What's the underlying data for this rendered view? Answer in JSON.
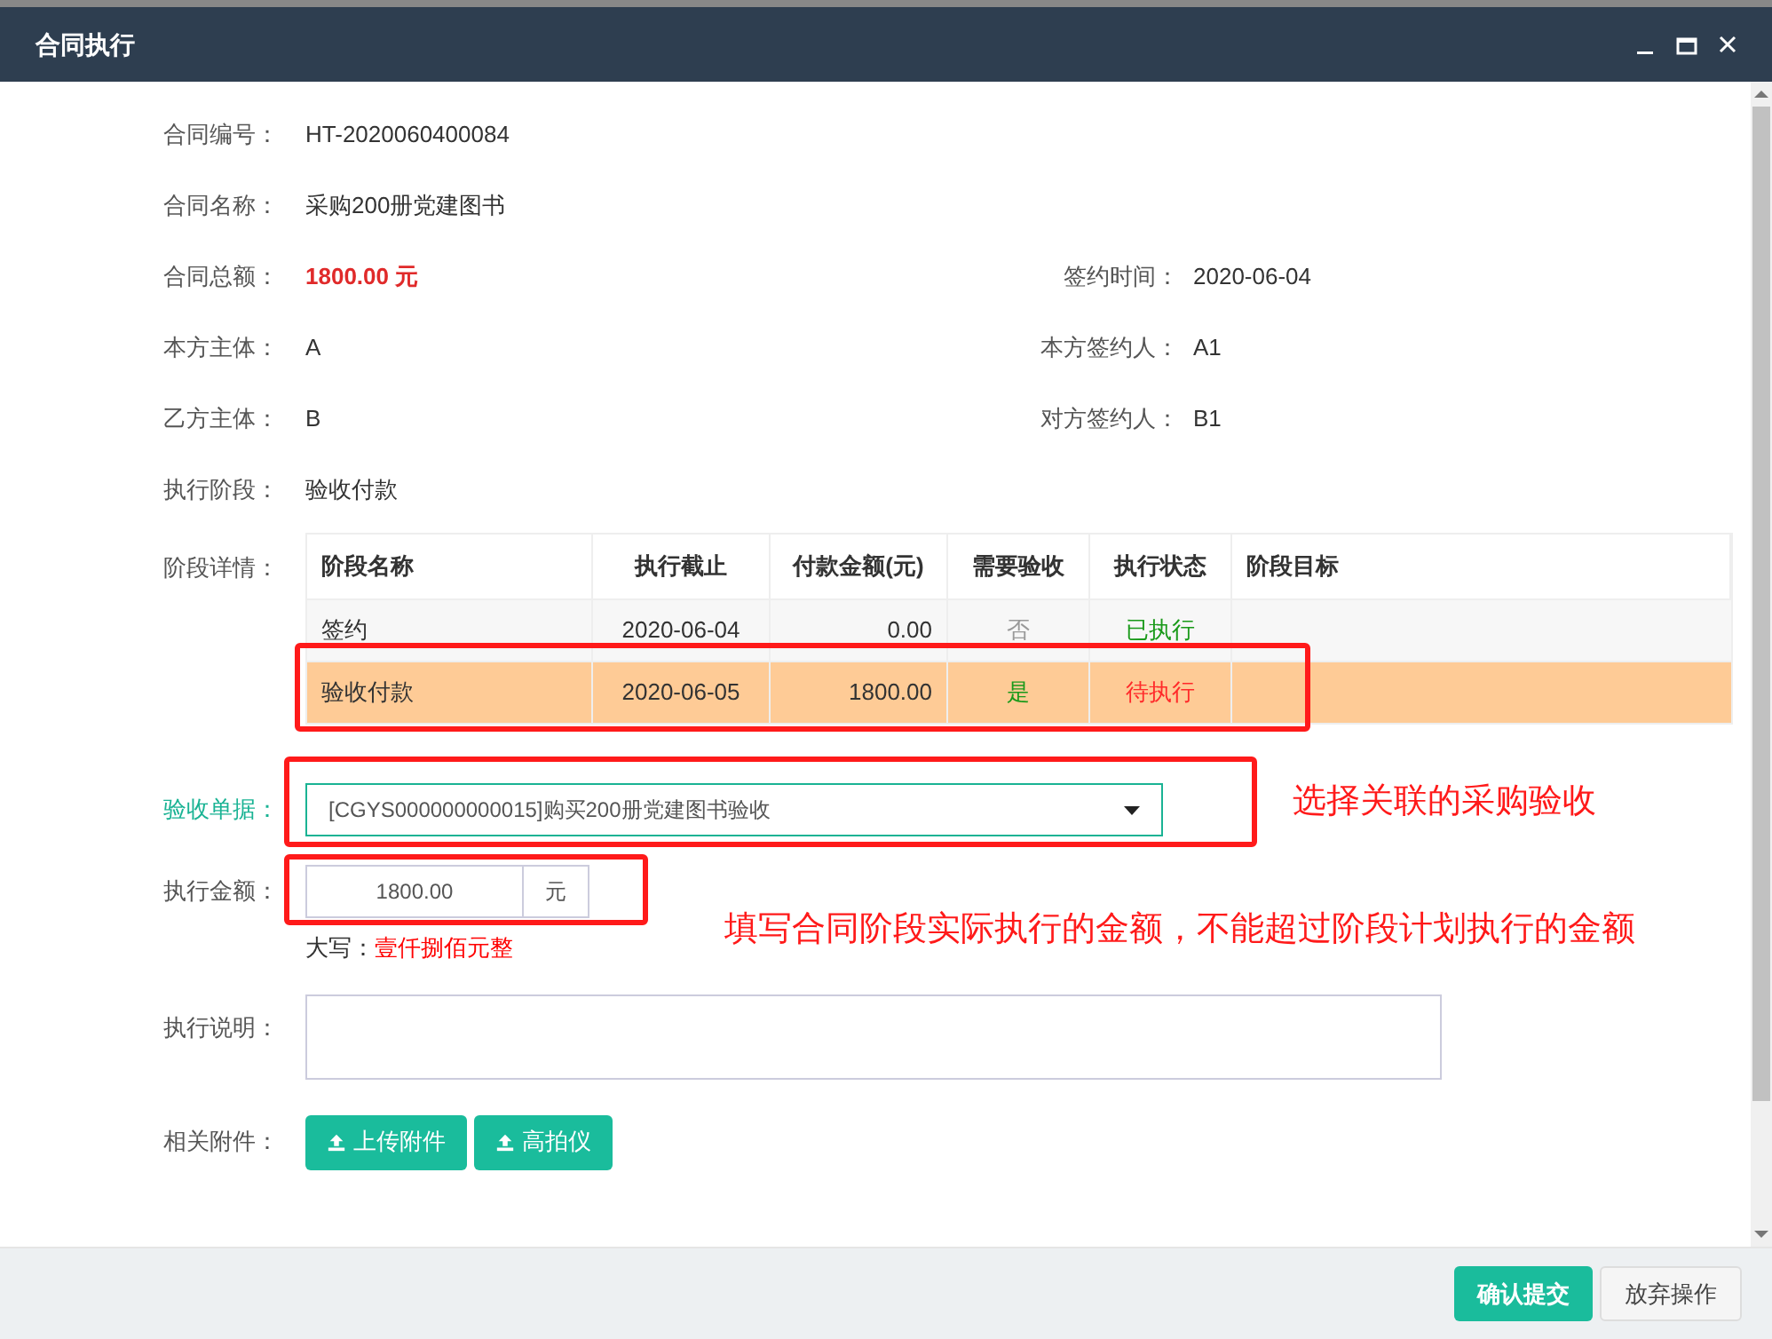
{
  "window": {
    "title": "合同执行"
  },
  "fields": [
    {
      "label": "合同编号：",
      "value": "HT-2020060400084"
    },
    {
      "label": "合同名称：",
      "value": "采购200册党建图书"
    },
    {
      "label": "合同总额：",
      "value": "1800.00 元",
      "kind": "amount",
      "right_label": "签约时间：",
      "right_value": "2020-06-04"
    },
    {
      "label": "本方主体：",
      "value": "A",
      "right_label": "本方签约人：",
      "right_value": "A1"
    },
    {
      "label": "乙方主体：",
      "value": "B",
      "right_label": "对方签约人：",
      "right_value": "B1"
    },
    {
      "label": "执行阶段：",
      "value": "验收付款"
    }
  ],
  "stage_table": {
    "label": "阶段详情：",
    "columns": [
      "阶段名称",
      "执行截止",
      "付款金额(元)",
      "需要验收",
      "执行状态",
      "阶段目标"
    ],
    "rows": [
      {
        "selected": false,
        "name": "签约",
        "deadline": "2020-06-04",
        "amount": "0.00",
        "acceptance": {
          "text": "否",
          "kind": "no"
        },
        "status": {
          "text": "已执行",
          "kind": "done"
        }
      },
      {
        "selected": true,
        "name": "验收付款",
        "deadline": "2020-06-05",
        "amount": "1800.00",
        "acceptance": {
          "text": "是",
          "kind": "yes"
        },
        "status": {
          "text": "待执行",
          "kind": "pending"
        }
      }
    ]
  },
  "receipt": {
    "label": "验收单据：",
    "value": "[CGYS000000000015]购买200册党建图书验收"
  },
  "exec_amount": {
    "label": "执行金额：",
    "value": "1800.00",
    "unit": "元",
    "caps_label": "大写：",
    "caps_value": "壹仟捌佰元整"
  },
  "exec_note": {
    "label": "执行说明："
  },
  "attachments": {
    "label": "相关附件：",
    "buttons": [
      "上传附件",
      "高拍仪"
    ]
  },
  "annotations": [
    "选择关联的采购验收",
    "填写合同阶段实际执行的金额，不能超过阶段计划执行的金额"
  ],
  "footer": {
    "buttons": [
      {
        "label": "确认提交",
        "kind": "primary"
      },
      {
        "label": "放弃操作",
        "kind": "default"
      }
    ]
  }
}
